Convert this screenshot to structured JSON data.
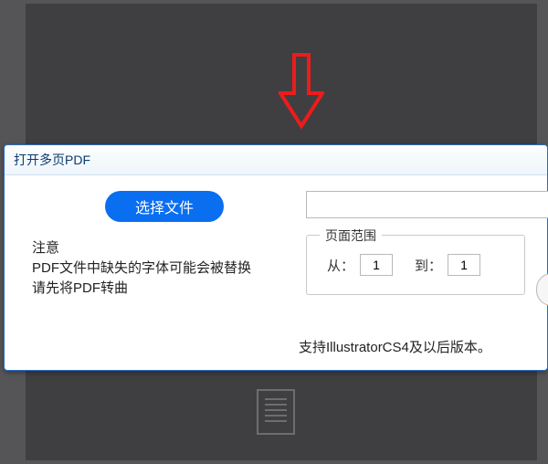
{
  "dialog": {
    "title": "打开多页PDF",
    "select_button": "选择文件",
    "file_path": "",
    "note_heading": "注意",
    "note_line1": "PDF文件中缺失的字体可能会被替换",
    "note_line2": "请先将PDF转曲",
    "range": {
      "legend": "页面范围",
      "from_label": "从：",
      "to_label": "到：",
      "from_value": "1",
      "to_value": "1"
    },
    "support_text": "支持IllustratorCS4及以后版本。"
  }
}
